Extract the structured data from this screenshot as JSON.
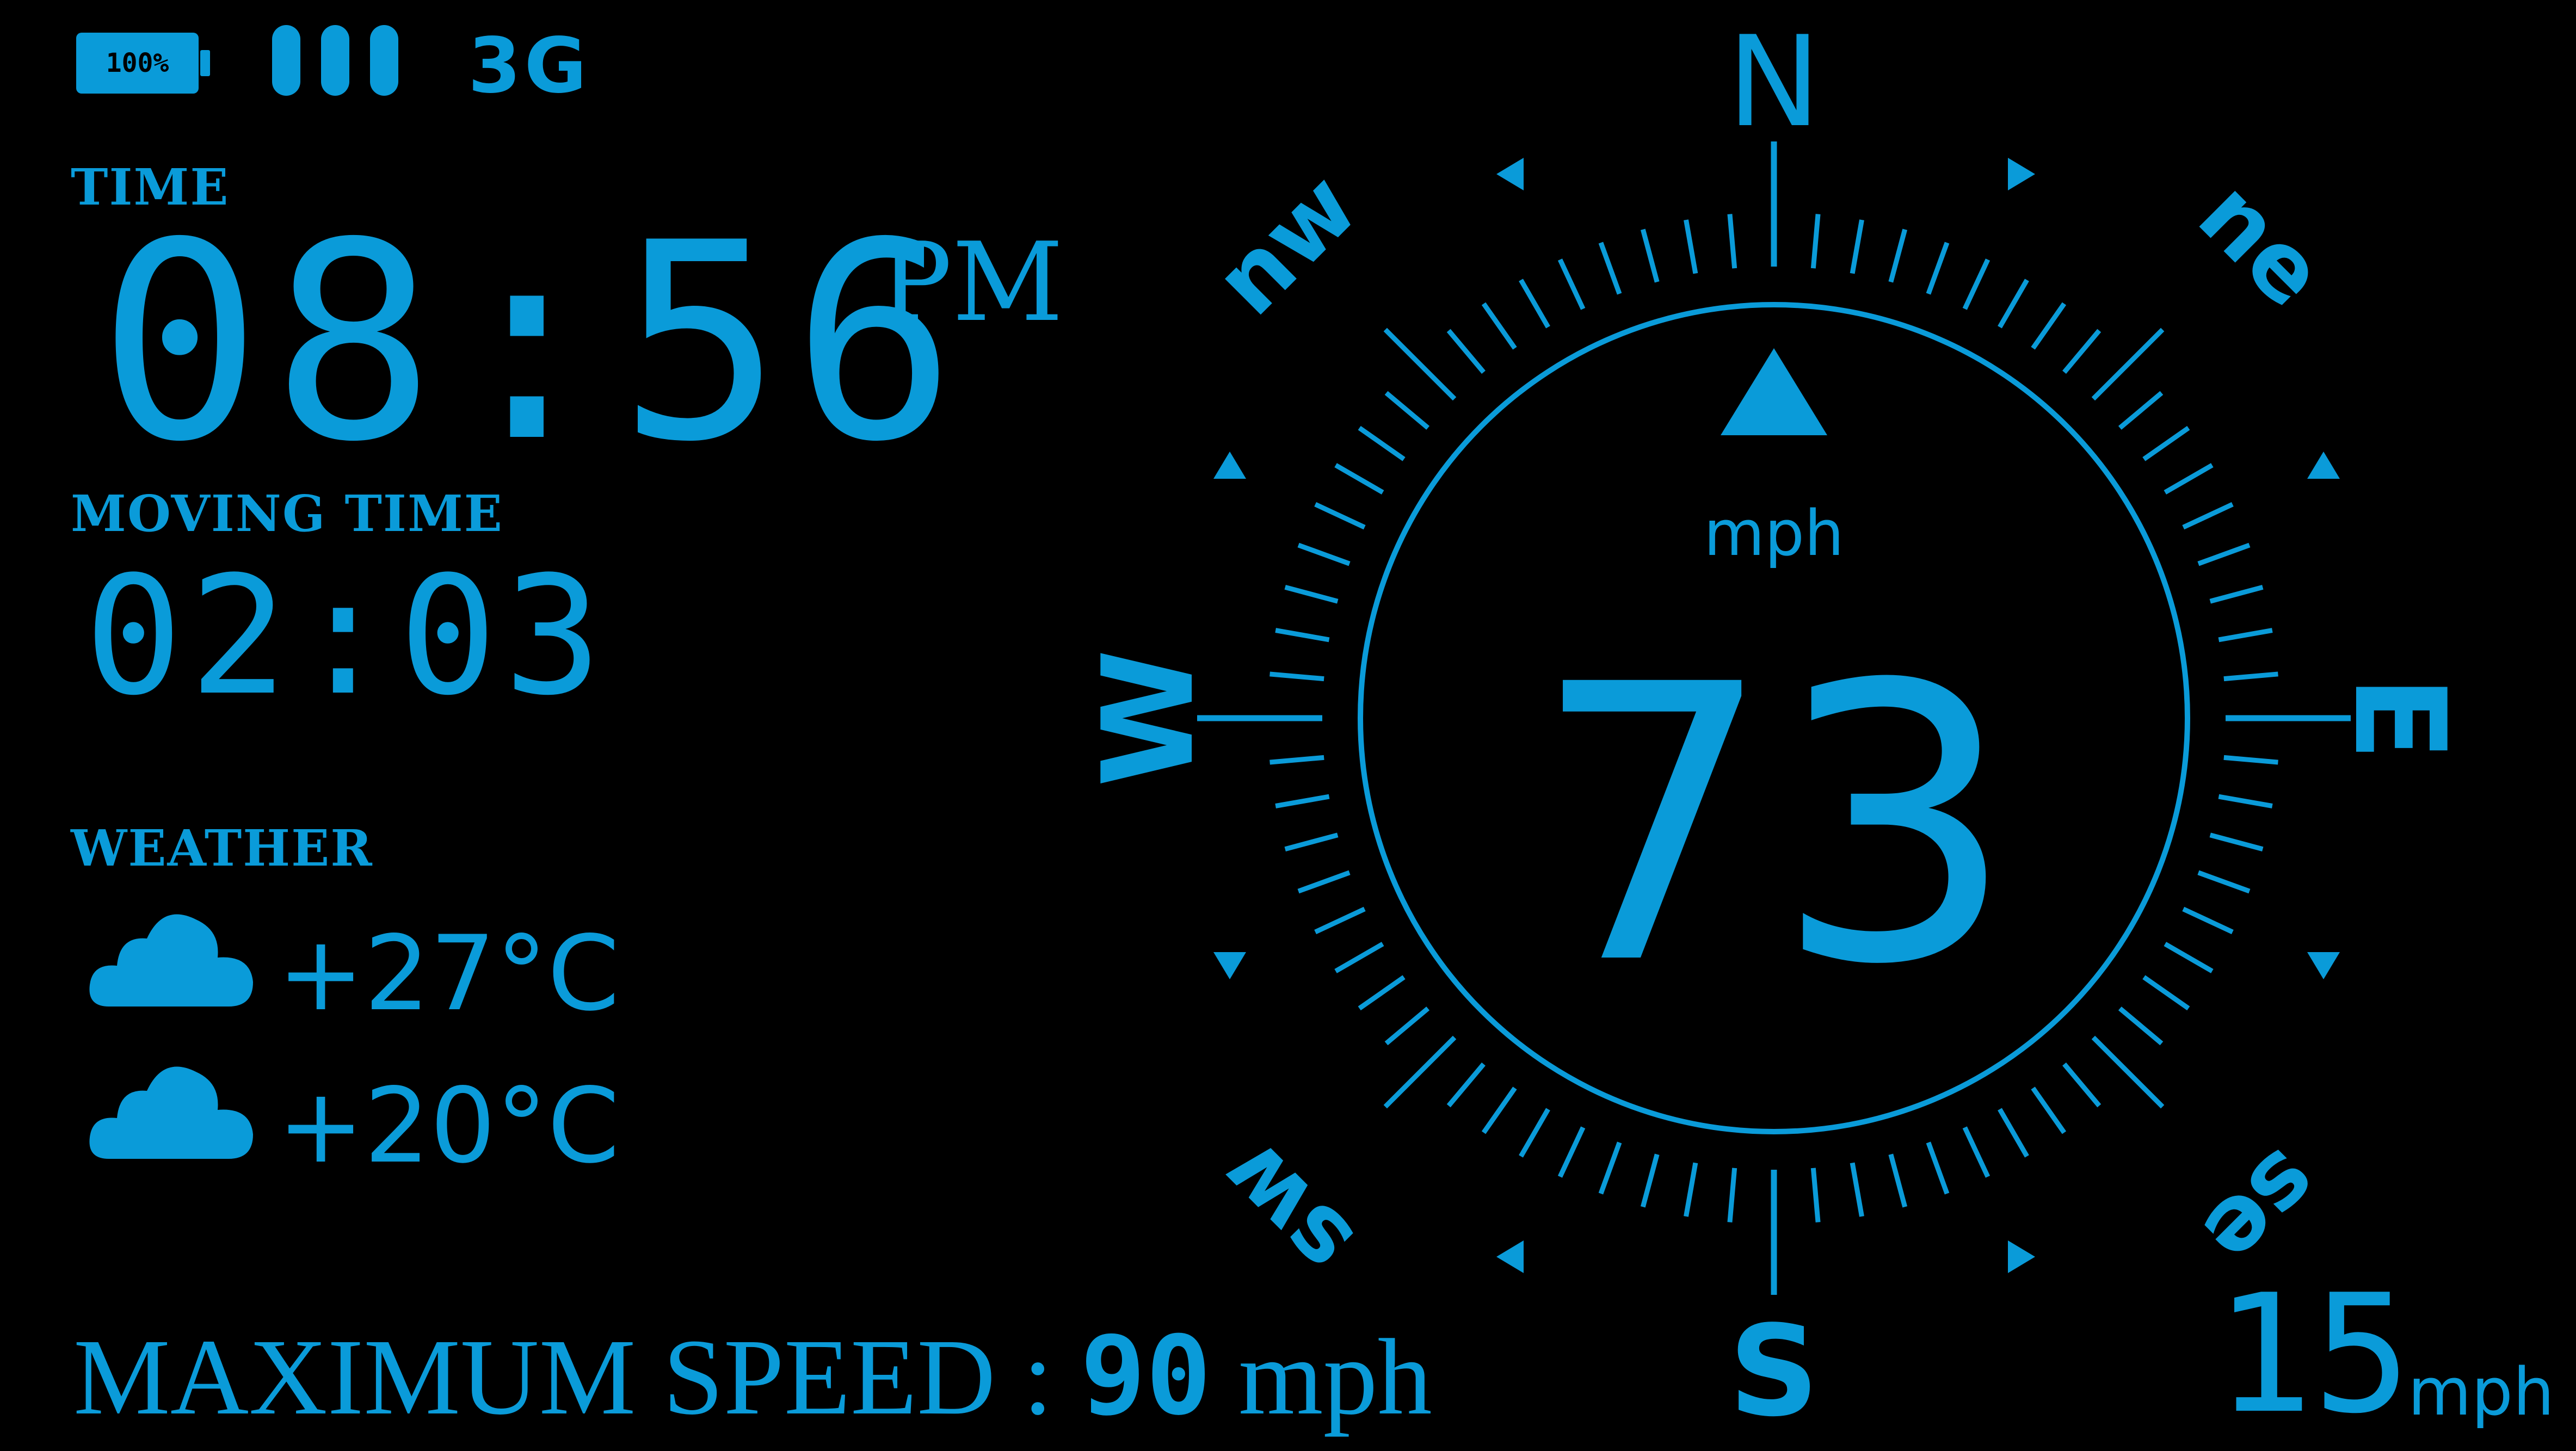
{
  "status": {
    "battery": "100%",
    "network": "3G",
    "signal_bars": 3
  },
  "time": {
    "label": "TIME",
    "value": "08:56",
    "period": "PM"
  },
  "moving_time": {
    "label": "MOVING TIME",
    "value": "02:03"
  },
  "weather": {
    "label": "WEATHER",
    "items": [
      {
        "icon": "cloud-icon",
        "temp": "+27°C"
      },
      {
        "icon": "cloud-icon",
        "temp": "+20°C"
      }
    ]
  },
  "max_speed": {
    "label": "MAXIMUM SPEED :",
    "value": "90",
    "unit": "mph"
  },
  "compass": {
    "north": "N",
    "south": "S",
    "east": "E",
    "west": "W",
    "nw": "nw",
    "ne": "ne",
    "sw": "sw",
    "se": "se"
  },
  "speedometer": {
    "unit": "mph",
    "value": "73"
  },
  "secondary_speed": {
    "value": "15",
    "unit": "mph"
  },
  "colors": {
    "accent": "#0a9bd9",
    "background": "#000000"
  }
}
